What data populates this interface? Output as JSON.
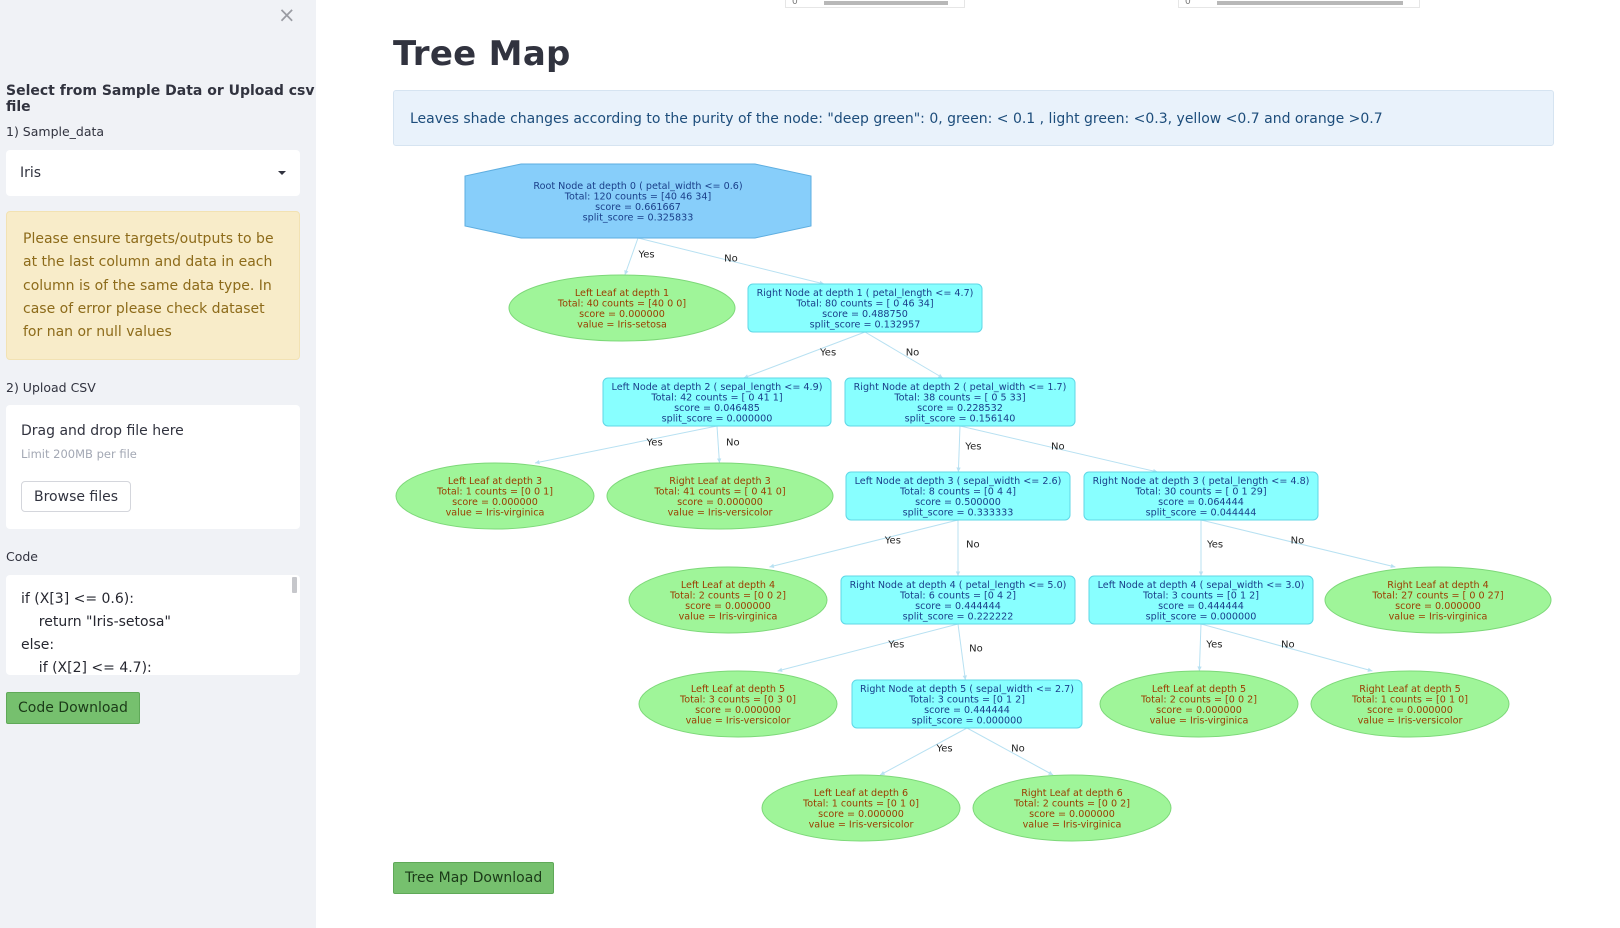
{
  "sidebar": {
    "close_icon": "×",
    "heading": "Select from Sample Data or Upload csv file",
    "sample_label": "1) Sample_data",
    "sample_value": "Iris",
    "warning_text": "Please ensure targets/outputs to be at the last column and data in each column is of the same data type. In case of error please check dataset for nan or null values",
    "upload_label": "2) Upload CSV",
    "upload_title": "Drag and drop file here",
    "upload_limit": "Limit 200MB per file",
    "browse_label": "Browse files",
    "code_label": "Code",
    "code_lines": [
      "if (X[3] <= 0.6):",
      "    return \"Iris-setosa\"",
      "else:",
      "    if (X[2] <= 4.7):"
    ],
    "code_download_label": "Code Download"
  },
  "main": {
    "title": "Tree Map",
    "info": "Leaves shade changes according to the purity of the node: \"deep green\": 0, green: < 0.1 , light green: <0.3, yellow <0.7 and orange >0.7",
    "download_label": "Tree Map Download",
    "slider_ticks": [
      "0",
      "0"
    ]
  },
  "colors": {
    "root_fill": "#87cefa",
    "internal_fill": "#88ffff",
    "leaf_fill": "#9ff599",
    "leaf_text": "#9b3d00",
    "internal_text": "#1a3f8a",
    "edge": "#b8e1f2"
  },
  "tree": {
    "nodes": [
      {
        "id": "root",
        "type": "root",
        "lines": [
          "Root Node at depth 0 ( petal_width <= 0.6)",
          "Total: 120   counts = [40 46 34]",
          "score = 0.661667",
          "split_score = 0.325833"
        ]
      },
      {
        "id": "l1",
        "type": "leaf",
        "lines": [
          "Left Leaf at depth 1",
          "Total: 40   counts = [40  0  0]",
          "score = 0.000000",
          "value = Iris-setosa"
        ]
      },
      {
        "id": "r1",
        "type": "internal",
        "lines": [
          "Right Node at depth 1 ( petal_length <= 4.7)",
          "Total: 80   counts = [ 0 46 34]",
          "score = 0.488750",
          "split_score = 0.132957"
        ]
      },
      {
        "id": "l2",
        "type": "internal",
        "lines": [
          "Left Node at depth 2 ( sepal_length <= 4.9)",
          "Total: 42   counts = [ 0 41  1]",
          "score = 0.046485",
          "split_score = 0.000000"
        ]
      },
      {
        "id": "r2",
        "type": "internal",
        "lines": [
          "Right Node at depth 2 ( petal_width <= 1.7)",
          "Total: 38   counts = [ 0  5 33]",
          "score = 0.228532",
          "split_score = 0.156140"
        ]
      },
      {
        "id": "l3a",
        "type": "leaf",
        "lines": [
          "Left Leaf at depth 3",
          "Total: 1   counts = [0 0 1]",
          "score = 0.000000",
          "value = Iris-virginica"
        ]
      },
      {
        "id": "r3a",
        "type": "leaf",
        "lines": [
          "Right Leaf at depth 3",
          "Total: 41   counts = [ 0 41  0]",
          "score = 0.000000",
          "value = Iris-versicolor"
        ]
      },
      {
        "id": "l3b",
        "type": "internal",
        "lines": [
          "Left Node at depth 3 ( sepal_width <= 2.6)",
          "Total: 8   counts = [0 4 4]",
          "score = 0.500000",
          "split_score = 0.333333"
        ]
      },
      {
        "id": "r3b",
        "type": "internal",
        "lines": [
          "Right Node at depth 3 ( petal_length <= 4.8)",
          "Total: 30   counts = [ 0  1 29]",
          "score = 0.064444",
          "split_score = 0.044444"
        ]
      },
      {
        "id": "l4a",
        "type": "leaf",
        "lines": [
          "Left Leaf at depth 4",
          "Total: 2   counts = [0 0 2]",
          "score = 0.000000",
          "value = Iris-virginica"
        ]
      },
      {
        "id": "r4a",
        "type": "internal",
        "lines": [
          "Right Node at depth 4 ( petal_length <= 5.0)",
          "Total: 6   counts = [0 4 2]",
          "score = 0.444444",
          "split_score = 0.222222"
        ]
      },
      {
        "id": "l4b",
        "type": "internal",
        "lines": [
          "Left Node at depth 4 ( sepal_width <= 3.0)",
          "Total: 3   counts = [0 1 2]",
          "score = 0.444444",
          "split_score = 0.000000"
        ]
      },
      {
        "id": "r4b",
        "type": "leaf",
        "lines": [
          "Right Leaf at depth 4",
          "Total: 27   counts = [ 0  0 27]",
          "score = 0.000000",
          "value = Iris-virginica"
        ]
      },
      {
        "id": "l5a",
        "type": "leaf",
        "lines": [
          "Left Leaf at depth 5",
          "Total: 3   counts = [0 3 0]",
          "score = 0.000000",
          "value = Iris-versicolor"
        ]
      },
      {
        "id": "r5a",
        "type": "internal",
        "lines": [
          "Right Node at depth 5 ( sepal_width <= 2.7)",
          "Total: 3   counts = [0 1 2]",
          "score = 0.444444",
          "split_score = 0.000000"
        ]
      },
      {
        "id": "l5b",
        "type": "leaf",
        "lines": [
          "Left Leaf at depth 5",
          "Total: 2   counts = [0 0 2]",
          "score = 0.000000",
          "value = Iris-virginica"
        ]
      },
      {
        "id": "r5b",
        "type": "leaf",
        "lines": [
          "Right Leaf at depth 5",
          "Total: 1   counts = [0 1 0]",
          "score = 0.000000",
          "value = Iris-versicolor"
        ]
      },
      {
        "id": "l6",
        "type": "leaf",
        "lines": [
          "Left Leaf at depth 6",
          "Total: 1   counts = [0 1 0]",
          "score = 0.000000",
          "value = Iris-versicolor"
        ]
      },
      {
        "id": "r6",
        "type": "leaf",
        "lines": [
          "Right Leaf at depth 6",
          "Total: 2   counts = [0 0 2]",
          "score = 0.000000",
          "value = Iris-virginica"
        ]
      }
    ],
    "edges": [
      {
        "from": "root",
        "to": "l1",
        "label": "Yes"
      },
      {
        "from": "root",
        "to": "r1",
        "label": "No"
      },
      {
        "from": "r1",
        "to": "l2",
        "label": "Yes"
      },
      {
        "from": "r1",
        "to": "r2",
        "label": "No"
      },
      {
        "from": "l2",
        "to": "l3a",
        "label": "Yes"
      },
      {
        "from": "l2",
        "to": "r3a",
        "label": "No"
      },
      {
        "from": "r2",
        "to": "l3b",
        "label": "Yes"
      },
      {
        "from": "r2",
        "to": "r3b",
        "label": "No"
      },
      {
        "from": "l3b",
        "to": "l4a",
        "label": "Yes"
      },
      {
        "from": "l3b",
        "to": "r4a",
        "label": "No"
      },
      {
        "from": "r3b",
        "to": "l4b",
        "label": "Yes"
      },
      {
        "from": "r3b",
        "to": "r4b",
        "label": "No"
      },
      {
        "from": "r4a",
        "to": "l5a",
        "label": "Yes"
      },
      {
        "from": "r4a",
        "to": "r5a",
        "label": "No"
      },
      {
        "from": "l4b",
        "to": "l5b",
        "label": "Yes"
      },
      {
        "from": "l4b",
        "to": "r5b",
        "label": "No"
      },
      {
        "from": "r5a",
        "to": "l6",
        "label": "Yes"
      },
      {
        "from": "r5a",
        "to": "r6",
        "label": "No"
      }
    ]
  }
}
